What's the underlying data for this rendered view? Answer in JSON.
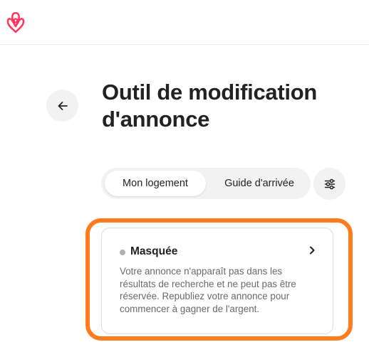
{
  "header": {
    "logo_icon": "airbnb-logo-icon",
    "brand_color": "#ff385c"
  },
  "nav": {
    "back_icon": "arrow-left-icon"
  },
  "page": {
    "title": "Outil de modification d'annonce"
  },
  "tabs": [
    {
      "label": "Mon logement",
      "active": true
    },
    {
      "label": "Guide d'arrivée",
      "active": false
    }
  ],
  "filter": {
    "icon": "sliders-icon"
  },
  "listing_status": {
    "title": "Masquée",
    "dot_color": "#b0b0b0",
    "description": "Votre annonce n'apparaît pas dans les résultats de recherche et ne peut pas être réservée. Republiez votre annonce pour commencer à gagner de l'argent.",
    "chevron_icon": "chevron-right-icon"
  },
  "colors": {
    "highlight": "#fe7b1e",
    "text": "#222222",
    "muted_text": "#6a6a6a",
    "pill_background": "#f2f2f2"
  }
}
